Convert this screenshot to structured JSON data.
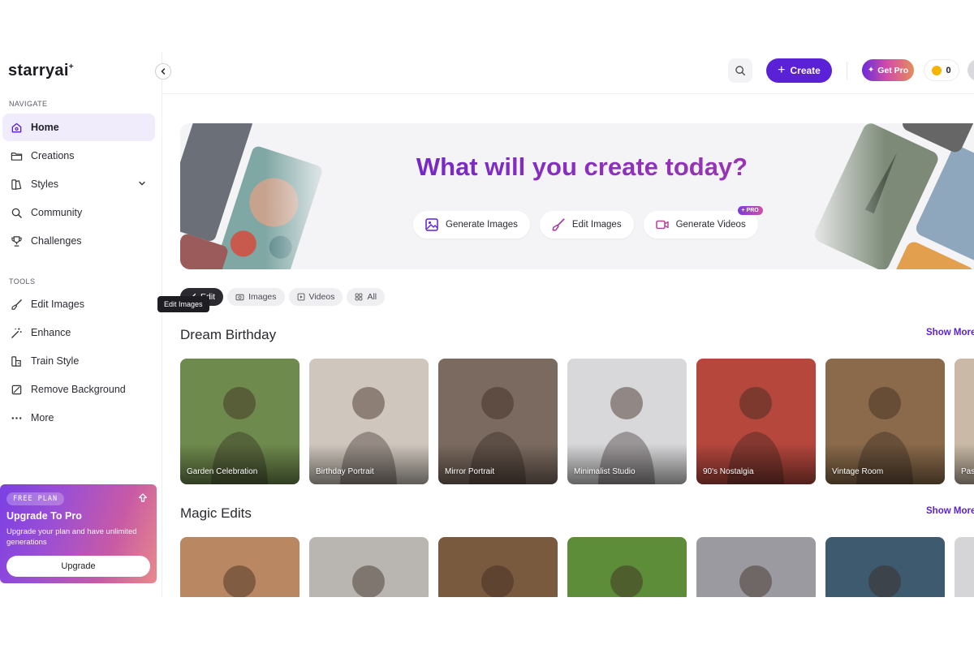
{
  "app": {
    "logo": "starryai",
    "logo_spark": "+"
  },
  "sidebar": {
    "navigate_title": "NAVIGATE",
    "navigate_items": [
      {
        "label": "Home",
        "icon": "home-icon"
      },
      {
        "label": "Creations",
        "icon": "folder-icon"
      },
      {
        "label": "Styles",
        "icon": "styles-icon"
      },
      {
        "label": "Community",
        "icon": "search-icon"
      },
      {
        "label": "Challenges",
        "icon": "trophy-icon"
      }
    ],
    "tools_title": "TOOLS",
    "tool_items": [
      {
        "label": "Edit Images",
        "icon": "brush-icon"
      },
      {
        "label": "Enhance",
        "icon": "magic-wand-icon"
      },
      {
        "label": "Train Style",
        "icon": "train-style-icon"
      },
      {
        "label": "Remove Background",
        "icon": "remove-bg-icon"
      },
      {
        "label": "More",
        "icon": "more-icon"
      }
    ],
    "tooltip": "Edit Images",
    "upgrade": {
      "badge": "FREE PLAN",
      "title": "Upgrade To Pro",
      "desc": "Upgrade your plan and have unlimited generations",
      "button": "Upgrade"
    }
  },
  "topbar": {
    "create_label": "Create",
    "getpro_label": "Get Pro",
    "coins": "0"
  },
  "hero": {
    "title": "What will you create today?",
    "actions": [
      {
        "label": "Generate Images",
        "icon": "image-icon"
      },
      {
        "label": "Edit Images",
        "icon": "brush-icon"
      },
      {
        "label": "Generate Videos",
        "icon": "video-icon",
        "tag": "+ PRO"
      }
    ]
  },
  "filters": [
    {
      "label": "Edit",
      "active": true
    },
    {
      "label": "Images"
    },
    {
      "label": "Videos"
    },
    {
      "label": "All"
    }
  ],
  "sections": [
    {
      "title": "Dream Birthday",
      "show_more": "Show More",
      "cards": [
        {
          "caption": "Garden Celebration",
          "bg": "#6f8a4d"
        },
        {
          "caption": "Birthday Portrait",
          "bg": "#cfc7bd"
        },
        {
          "caption": "Mirror Portrait",
          "bg": "#7b6a5f"
        },
        {
          "caption": "Minimalist Studio",
          "bg": "#d8d8da"
        },
        {
          "caption": "90's Nostalgia",
          "bg": "#b5473d"
        },
        {
          "caption": "Vintage Room",
          "bg": "#8a6a4a"
        },
        {
          "caption": "Pas",
          "bg": "#c9b9a6"
        }
      ]
    },
    {
      "title": "Magic Edits",
      "show_more": "Show More",
      "cards": [
        {
          "bg": "#b98762"
        },
        {
          "bg": "#b9b6b2"
        },
        {
          "bg": "#7a5a3f"
        },
        {
          "bg": "#5e8d3a"
        },
        {
          "bg": "#9a9aa0"
        },
        {
          "bg": "#3d5a6e"
        },
        {
          "bg": "#d5d5d8"
        }
      ]
    }
  ]
}
